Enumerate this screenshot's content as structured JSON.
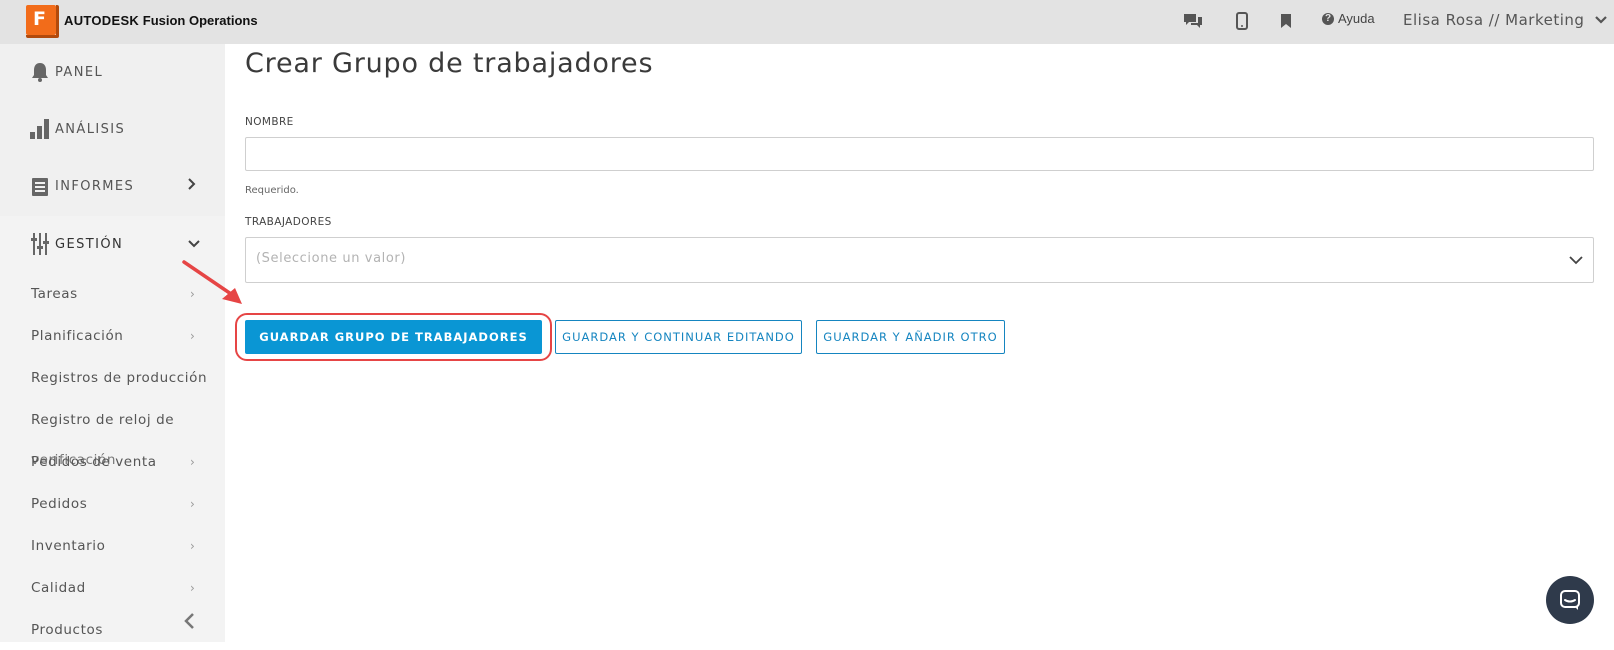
{
  "header": {
    "brand_bold": "AUTODESK",
    "brand_product": "Fusion Operations",
    "logo_letter": "F",
    "help_label": "Ayuda",
    "user_label": "Elisa Rosa // Marketing",
    "icons": [
      "chat-icon",
      "mobile-icon",
      "bookmark-icon",
      "help-icon",
      "chevron-down-icon"
    ]
  },
  "sidebar": {
    "main_items": [
      {
        "label": "PANEL",
        "icon": "bell-icon"
      },
      {
        "label": "ANÁLISIS",
        "icon": "bar-chart-icon"
      },
      {
        "label": "INFORMES",
        "icon": "document-icon"
      },
      {
        "label": "GESTIÓN",
        "icon": "sliders-icon"
      }
    ],
    "sub_items": [
      {
        "label": "Tareas"
      },
      {
        "label": "Planificación"
      },
      {
        "label": "Registros de producción"
      },
      {
        "label": "Registro de reloj de"
      },
      {
        "label": "Pedidos de venta"
      },
      {
        "label": "Pedidos"
      },
      {
        "label": "Inventario"
      },
      {
        "label": "Calidad"
      },
      {
        "label": "Productos"
      }
    ],
    "overlap_text": "verificación"
  },
  "main": {
    "title": "Crear Grupo de trabajadores",
    "name_label": "NOMBRE",
    "name_value": "",
    "required_hint": "Requerido.",
    "workers_label": "TRABAJADORES",
    "workers_placeholder": "(Seleccione un valor)",
    "buttons": {
      "save": "GUARDAR GRUPO DE TRABAJADORES",
      "save_continue": "GUARDAR Y CONTINUAR EDITANDO",
      "save_add": "GUARDAR Y AÑADIR OTRO"
    }
  },
  "colors": {
    "accent": "#0a96d4",
    "highlight": "#e64545",
    "logo": "#f26c1a"
  }
}
